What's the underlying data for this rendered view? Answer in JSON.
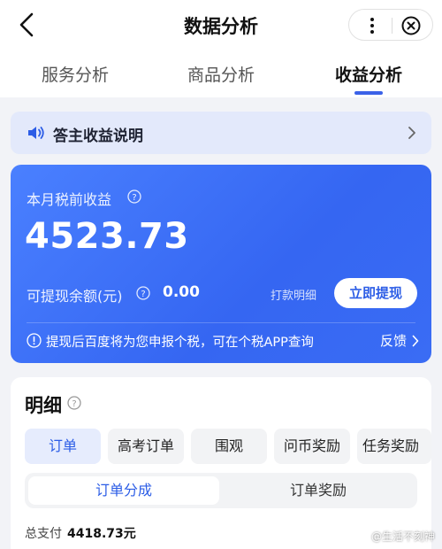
{
  "nav": {
    "title": "数据分析"
  },
  "tabs": [
    {
      "label": "服务分析"
    },
    {
      "label": "商品分析"
    },
    {
      "label": "收益分析"
    }
  ],
  "notice": {
    "label": "答主收益说明"
  },
  "earnings": {
    "month_label": "本月税前收益",
    "amount": "4523.73",
    "withdrawable_label": "可提现余额(元)",
    "withdrawable_value": "0.00",
    "detail_link": "打款明细",
    "withdraw_button": "立即提现",
    "tip": "提现后百度将为您申报个税，可在个税APP查询",
    "feedback": "反馈"
  },
  "details": {
    "title": "明细",
    "chips": [
      "订单",
      "高考订单",
      "围观",
      "问币奖励",
      "任务奖励"
    ],
    "segments": [
      "订单分成",
      "订单奖励"
    ],
    "total_label": "总支付",
    "total_value": "4418.73元"
  },
  "watermark": "@生活不刻神",
  "colors": {
    "accent": "#3b62e8",
    "card": "#3566f2"
  }
}
